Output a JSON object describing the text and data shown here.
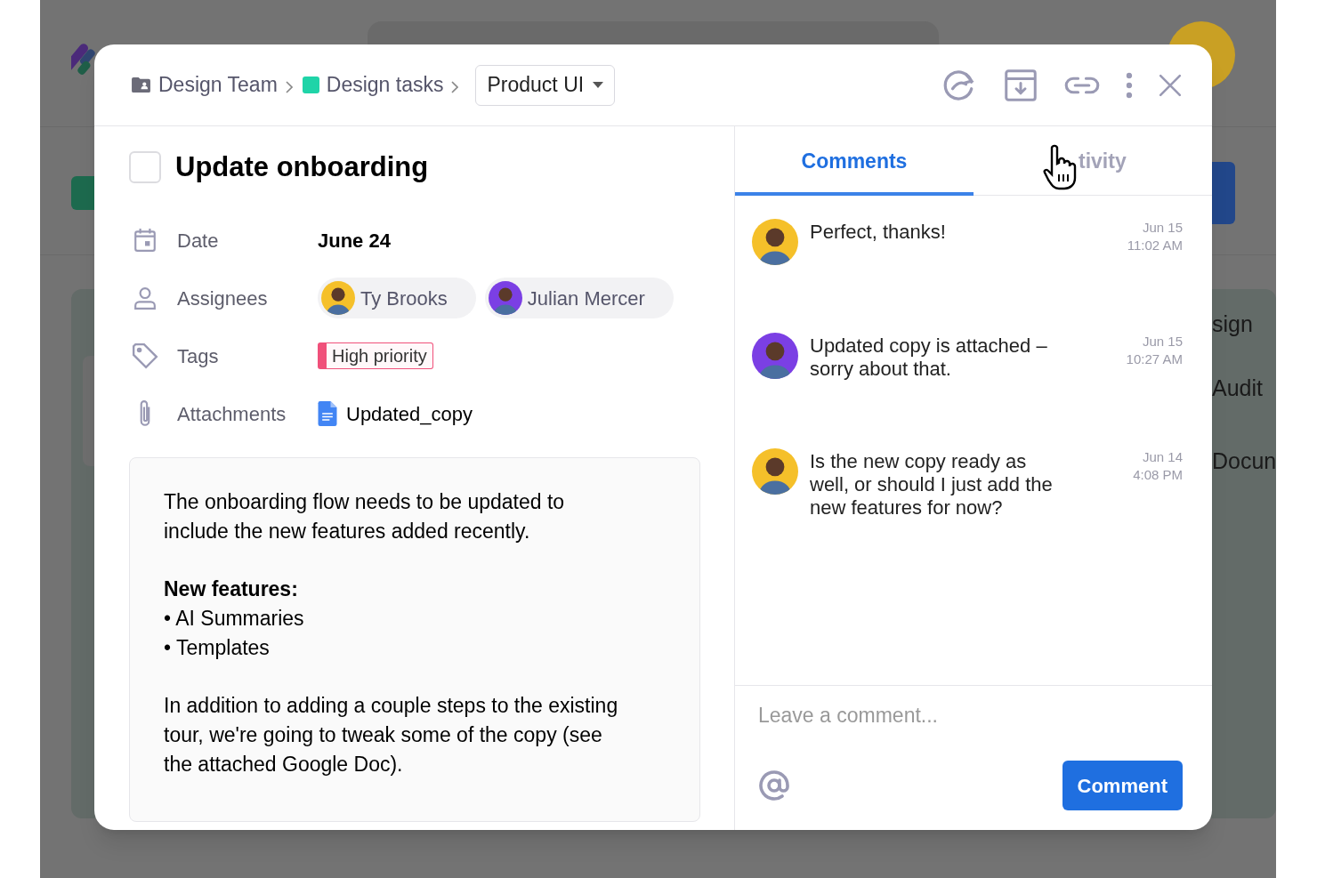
{
  "background": {
    "cards": [
      {
        "title": "sign"
      },
      {
        "title": "Audit"
      },
      {
        "title": "Docun"
      }
    ]
  },
  "breadcrumbs": [
    {
      "kind": "folder",
      "label": "Design Team"
    },
    {
      "kind": "list",
      "label": "Design tasks",
      "color": "#1fd4a8"
    }
  ],
  "project_dropdown": {
    "label": "Product UI"
  },
  "task": {
    "title": "Update onboarding",
    "completed": false
  },
  "fields": [
    {
      "kind": "date",
      "label": "Date",
      "value": "June 24"
    },
    {
      "kind": "people",
      "label": "Assignees",
      "people": [
        {
          "name": "Ty Brooks",
          "color": "#f5c02a"
        },
        {
          "name": "Julian Mercer",
          "color": "#7b3fe4"
        }
      ]
    },
    {
      "kind": "tags",
      "label": "Tags",
      "tags": [
        {
          "label": "High priority",
          "color": "#f0507a"
        }
      ]
    },
    {
      "kind": "attachments",
      "label": "Attachments",
      "files": [
        {
          "name": "Updated_copy"
        }
      ]
    }
  ],
  "description": [
    {
      "kind": "paragraph",
      "text": "The onboarding flow needs to be updated to include the new features added recently."
    },
    {
      "kind": "heading",
      "text": "New features:"
    },
    {
      "kind": "bullet",
      "text": "• AI Summaries"
    },
    {
      "kind": "bullet",
      "text": "• Templates"
    },
    {
      "kind": "paragraph",
      "text": "In addition to adding a couple steps to the existing tour, we're going to tweak some of the copy (see the attached Google Doc)."
    }
  ],
  "tabs": [
    {
      "label": "Comments",
      "selected": true
    },
    {
      "label": "tivity",
      "selected": false
    }
  ],
  "comments": [
    {
      "text": "Perfect, thanks!",
      "date": "Jun 15",
      "time": "11:02 AM",
      "color": "#f5c02a"
    },
    {
      "text": "Updated copy is attached – sorry about that.",
      "date": "Jun 15",
      "time": "10:27 AM",
      "color": "#7b3fe4"
    },
    {
      "text": "Is the new copy ready as well, or should I just add the new features for now?",
      "date": "Jun 14",
      "time": "4:08 PM",
      "color": "#f5c02a"
    }
  ],
  "composer": {
    "placeholder": "Leave a comment...",
    "button": "Comment"
  }
}
